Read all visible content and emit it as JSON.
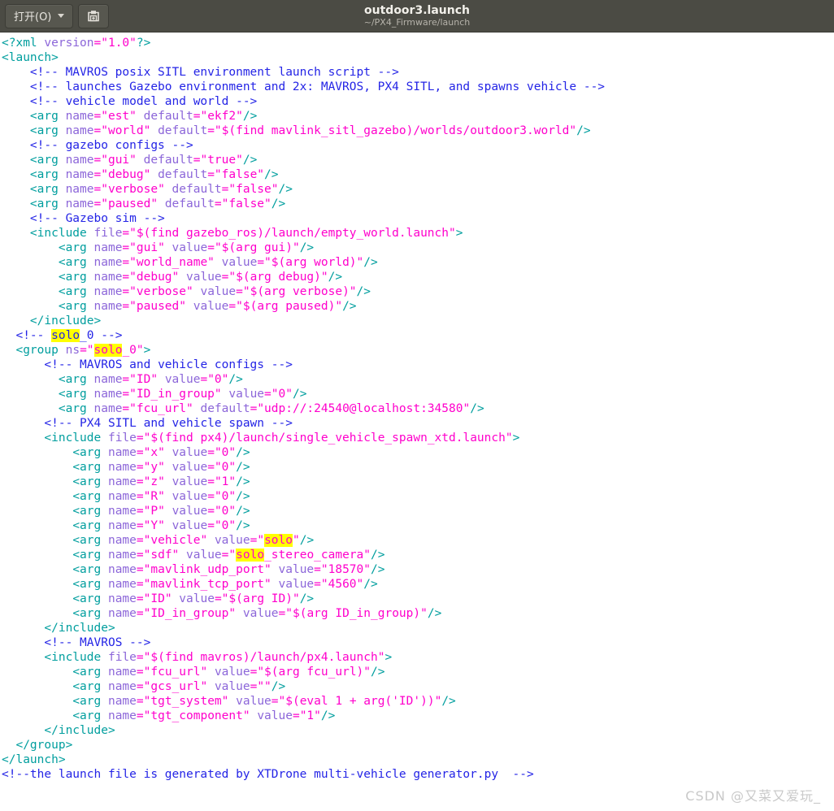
{
  "titlebar": {
    "open_button_label": "打开(O)",
    "open_button_icon": "chevron-down-icon",
    "save_button_icon": "save-floppy-plus-icon",
    "title": "outdoor3.launch",
    "subtitle": "~/PX4_Firmware/launch",
    "background_color": "#4b4b44",
    "title_color": "#f2f0ea",
    "subtitle_color": "#b6b3ab"
  },
  "editor": {
    "background_color": "#ffffff",
    "font_size_px": 14.5,
    "line_height_px": 18,
    "colors": {
      "tag": "#009e9e",
      "attribute": "#8c66d9",
      "string": "#ff00cc",
      "comment": "#2424e6",
      "search_highlight": "#ffff00"
    },
    "lines": [
      "<?xml version=\"1.0\"?>",
      "<launch>",
      "    <!-- MAVROS posix SITL environment launch script -->",
      "    <!-- launches Gazebo environment and 2x: MAVROS, PX4 SITL, and spawns vehicle -->",
      "    <!-- vehicle model and world -->",
      "    <arg name=\"est\" default=\"ekf2\"/>",
      "    <arg name=\"world\" default=\"$(find mavlink_sitl_gazebo)/worlds/outdoor3.world\"/>",
      "    <!-- gazebo configs -->",
      "    <arg name=\"gui\" default=\"true\"/>",
      "    <arg name=\"debug\" default=\"false\"/>",
      "    <arg name=\"verbose\" default=\"false\"/>",
      "    <arg name=\"paused\" default=\"false\"/>",
      "    <!-- Gazebo sim -->",
      "    <include file=\"$(find gazebo_ros)/launch/empty_world.launch\">",
      "        <arg name=\"gui\" value=\"$(arg gui)\"/>",
      "        <arg name=\"world_name\" value=\"$(arg world)\"/>",
      "        <arg name=\"debug\" value=\"$(arg debug)\"/>",
      "        <arg name=\"verbose\" value=\"$(arg verbose)\"/>",
      "        <arg name=\"paused\" value=\"$(arg paused)\"/>",
      "    </include>",
      "  <!-- solo_0 -->",
      "  <group ns=\"solo_0\">",
      "      <!-- MAVROS and vehicle configs -->",
      "        <arg name=\"ID\" value=\"0\"/>",
      "        <arg name=\"ID_in_group\" value=\"0\"/>",
      "        <arg name=\"fcu_url\" default=\"udp://:24540@localhost:34580\"/>",
      "      <!-- PX4 SITL and vehicle spawn -->",
      "      <include file=\"$(find px4)/launch/single_vehicle_spawn_xtd.launch\">",
      "          <arg name=\"x\" value=\"0\"/>",
      "          <arg name=\"y\" value=\"0\"/>",
      "          <arg name=\"z\" value=\"1\"/>",
      "          <arg name=\"R\" value=\"0\"/>",
      "          <arg name=\"P\" value=\"0\"/>",
      "          <arg name=\"Y\" value=\"0\"/>",
      "          <arg name=\"vehicle\" value=\"solo\"/>",
      "          <arg name=\"sdf\" value=\"solo_stereo_camera\"/>",
      "          <arg name=\"mavlink_udp_port\" value=\"18570\"/>",
      "          <arg name=\"mavlink_tcp_port\" value=\"4560\"/>",
      "          <arg name=\"ID\" value=\"$(arg ID)\"/>",
      "          <arg name=\"ID_in_group\" value=\"$(arg ID_in_group)\"/>",
      "      </include>",
      "      <!-- MAVROS -->",
      "      <include file=\"$(find mavros)/launch/px4.launch\">",
      "          <arg name=\"fcu_url\" value=\"$(arg fcu_url)\"/>",
      "          <arg name=\"gcs_url\" value=\"\"/>",
      "          <arg name=\"tgt_system\" value=\"$(eval 1 + arg('ID'))\"/>",
      "          <arg name=\"tgt_component\" value=\"1\"/>",
      "      </include>",
      "  </group>",
      "</launch>",
      "<!--the launch file is generated by XTDrone multi-vehicle generator.py  -->"
    ],
    "search_term": "solo"
  },
  "watermark": {
    "text": "CSDN @又菜又爱玩_"
  }
}
